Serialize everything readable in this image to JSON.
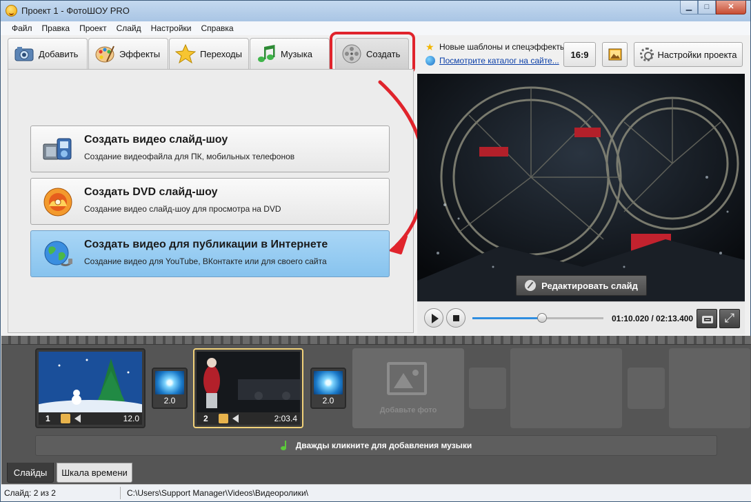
{
  "window": {
    "title": "Проект 1 - ФотоШОУ PRO"
  },
  "menu": [
    "Файл",
    "Правка",
    "Проект",
    "Слайд",
    "Настройки",
    "Справка"
  ],
  "tabs": [
    {
      "label": "Добавить",
      "icon": "camera-icon"
    },
    {
      "label": "Эффекты",
      "icon": "palette-icon"
    },
    {
      "label": "Переходы",
      "icon": "star-icon"
    },
    {
      "label": "Музыка",
      "icon": "music-note-icon"
    },
    {
      "label": "Создать",
      "icon": "film-reel-icon",
      "active": true
    }
  ],
  "actions": [
    {
      "title": "Создать видео слайд-шоу",
      "subtitle": "Создание видеофайла для ПК, мобильных телефонов",
      "icon": "video-devices-icon"
    },
    {
      "title": "Создать DVD слайд-шоу",
      "subtitle": "Создание видео слайд-шоу для просмотра на DVD",
      "icon": "dvd-disc-icon"
    },
    {
      "title": "Создать видео для публикации в Интернете",
      "subtitle": "Создание видео для YouTube, ВКонтакте или для своего сайта",
      "icon": "globe-icon",
      "selected": true
    }
  ],
  "news": {
    "line1": "Новые шаблоны и спецэффекты",
    "line2": "Посмотрите каталог на сайте..."
  },
  "toolbar": {
    "ratio": "16:9",
    "settings": "Настройки проекта"
  },
  "preview": {
    "edit_slide": "Редактировать слайд"
  },
  "player": {
    "time": "01:10.020 / 02:13.400",
    "progress": 0.53
  },
  "slides": [
    {
      "num": "1",
      "duration": "12.0"
    },
    {
      "num": "2",
      "duration": "2:03.4",
      "selected": true
    }
  ],
  "transitions": [
    {
      "duration": "2.0"
    },
    {
      "duration": "2.0"
    }
  ],
  "add_photo": "Добавьте фото",
  "music_hint": "Дважды кликните для добавления музыки",
  "bottom_tabs": [
    {
      "label": "Слайды"
    },
    {
      "label": "Шкала времени"
    }
  ],
  "status": {
    "slide": "Слайд: 2 из 2",
    "path": "C:\\Users\\Support Manager\\Videos\\Видеоролики\\"
  },
  "colors": {
    "highlight": "#e0242c",
    "selected_action": "#87c3ee",
    "accent_blue": "#2e8de0"
  }
}
